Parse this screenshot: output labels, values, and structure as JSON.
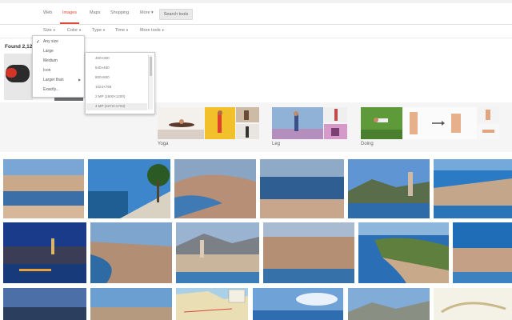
{
  "nav": {
    "tabs": [
      {
        "label": "Web"
      },
      {
        "label": "Images"
      },
      {
        "label": "Maps"
      },
      {
        "label": "Shopping"
      },
      {
        "label": "More ▾"
      }
    ],
    "search_tools": "Search tools"
  },
  "tools": [
    {
      "label": "Size"
    },
    {
      "label": "Color"
    },
    {
      "label": "Type"
    },
    {
      "label": "Time"
    },
    {
      "label": "More tools"
    }
  ],
  "size_menu": {
    "items": [
      "Any size",
      "Large",
      "Medium",
      "Icon",
      "Larger than",
      "Exactly..."
    ],
    "selected": "Any size"
  },
  "larger_than_menu": {
    "items": [
      "400×300",
      "640×480",
      "800×600",
      "1024×768",
      "2 MP (1600×1200)",
      "4 MP (2272×1704)"
    ],
    "highlighted": "4 MP (2272×1704)"
  },
  "results": {
    "found_text": "Found 2,120"
  },
  "related": [
    {
      "label": "Yoga"
    },
    {
      "label": "Leg"
    },
    {
      "label": "Doing"
    }
  ],
  "colors": {
    "accent": "#dd4b39",
    "link": "#777777"
  }
}
